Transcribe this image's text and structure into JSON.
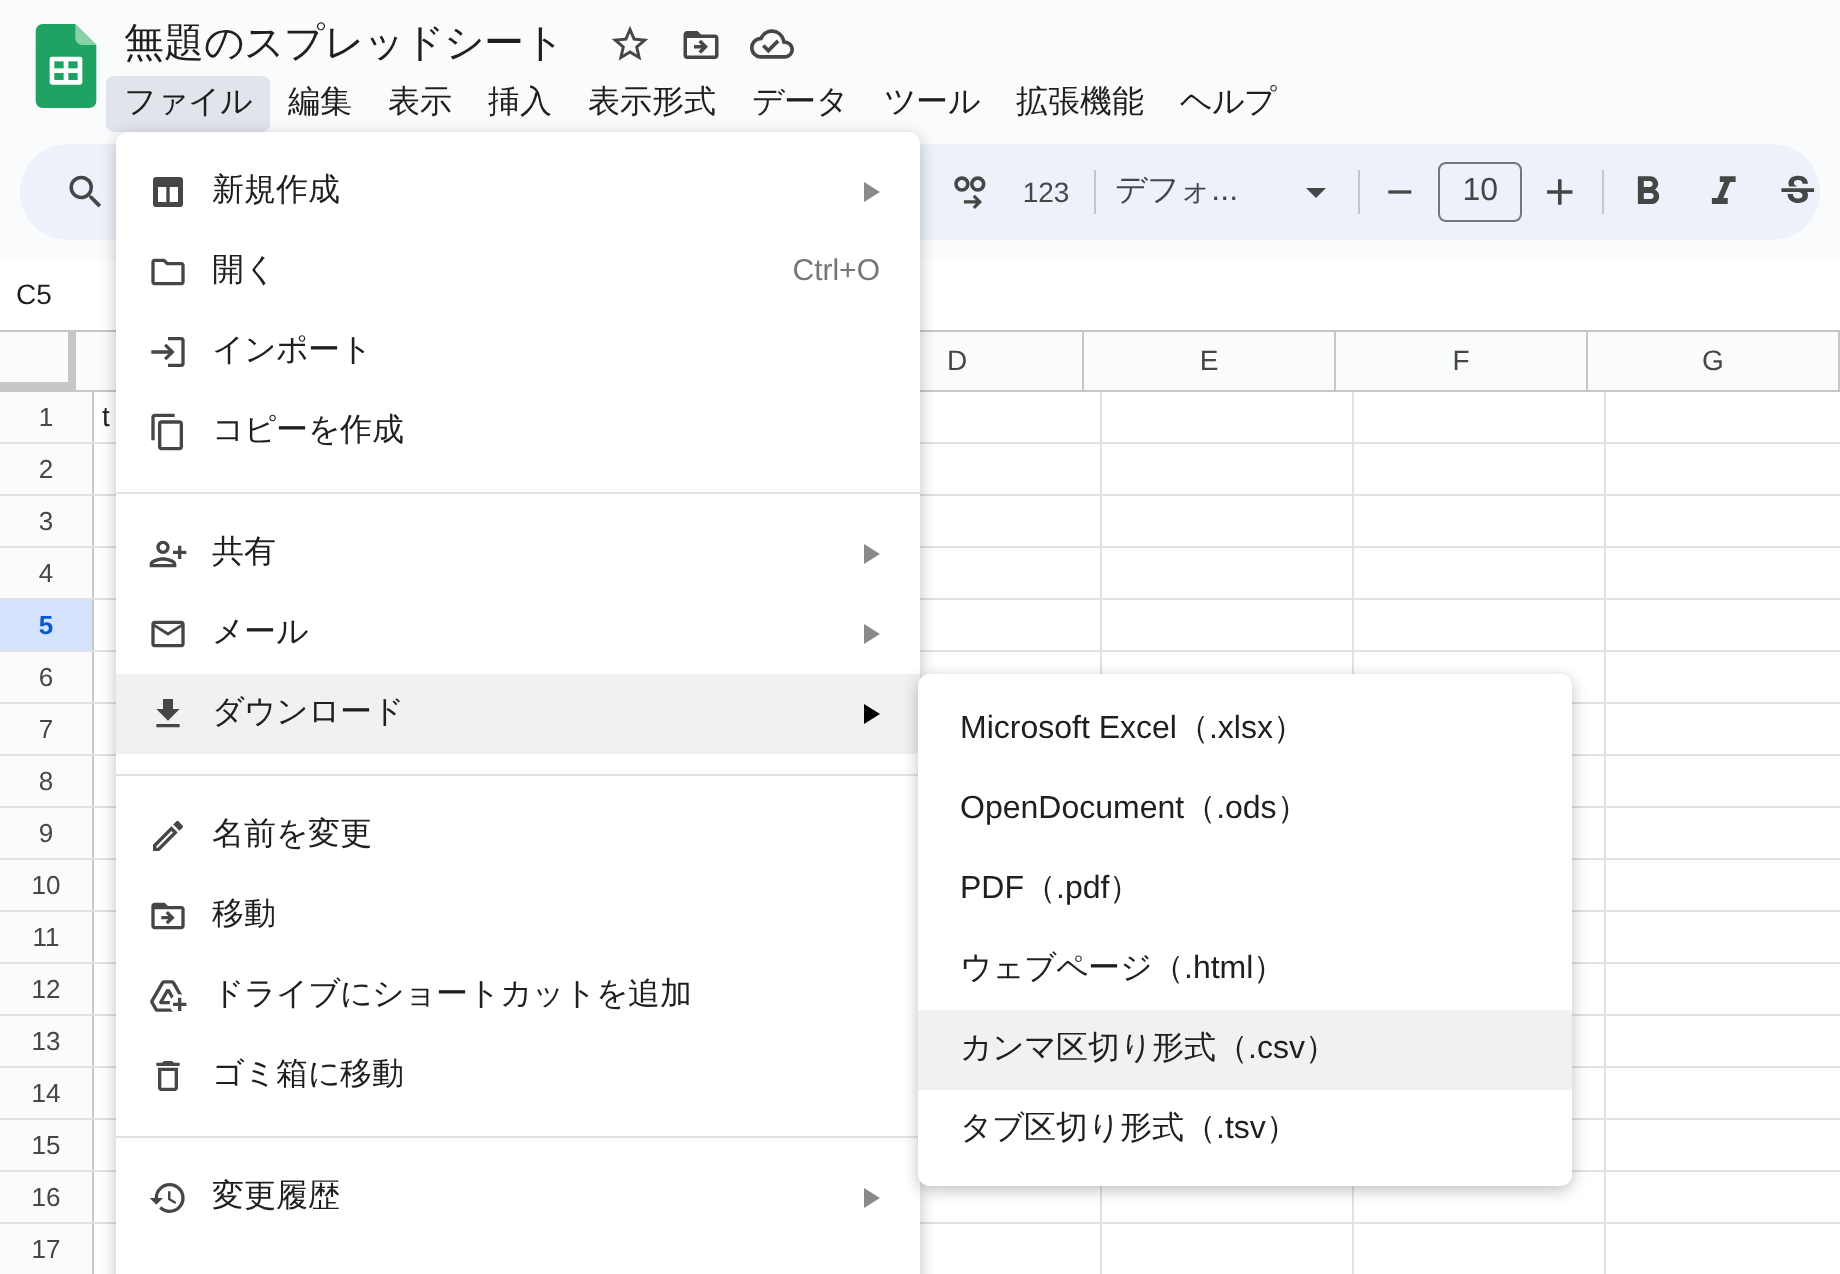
{
  "app": {
    "title": "無題のスプレッドシート"
  },
  "menu_bar": [
    {
      "label": "ファイル",
      "selected": true
    },
    {
      "label": "編集",
      "selected": false
    },
    {
      "label": "表示",
      "selected": false
    },
    {
      "label": "挿入",
      "selected": false
    },
    {
      "label": "表示形式",
      "selected": false
    },
    {
      "label": "データ",
      "selected": false
    },
    {
      "label": "ツール",
      "selected": false
    },
    {
      "label": "拡張機能",
      "selected": false
    },
    {
      "label": "ヘルプ",
      "selected": false
    }
  ],
  "toolbar": {
    "number_format": "123",
    "font": "デフォ...",
    "font_size": "10"
  },
  "name_box": "C5",
  "grid": {
    "columns": [
      "D",
      "E",
      "F",
      "G"
    ],
    "rows": [
      {
        "number": "1",
        "selected": false,
        "cell_a": "t"
      },
      {
        "number": "2",
        "selected": false
      },
      {
        "number": "3",
        "selected": false
      },
      {
        "number": "4",
        "selected": false
      },
      {
        "number": "5",
        "selected": true
      },
      {
        "number": "6",
        "selected": false
      },
      {
        "number": "7",
        "selected": false
      },
      {
        "number": "8",
        "selected": false
      },
      {
        "number": "9",
        "selected": false
      },
      {
        "number": "10",
        "selected": false
      },
      {
        "number": "11",
        "selected": false
      },
      {
        "number": "12",
        "selected": false
      },
      {
        "number": "13",
        "selected": false
      },
      {
        "number": "14",
        "selected": false
      },
      {
        "number": "15",
        "selected": false
      },
      {
        "number": "16",
        "selected": false
      },
      {
        "number": "17",
        "selected": false
      }
    ]
  },
  "file_menu": [
    {
      "kind": "item",
      "label": "新規作成",
      "submenu": true,
      "highlighted": false
    },
    {
      "kind": "item",
      "label": "開く",
      "shortcut": "Ctrl+O",
      "highlighted": false
    },
    {
      "kind": "item",
      "label": "インポート",
      "highlighted": false
    },
    {
      "kind": "item",
      "label": "コピーを作成",
      "highlighted": false
    },
    {
      "kind": "divider"
    },
    {
      "kind": "item",
      "label": "共有",
      "submenu": true,
      "highlighted": false
    },
    {
      "kind": "item",
      "label": "メール",
      "submenu": true,
      "highlighted": false
    },
    {
      "kind": "item",
      "label": "ダウンロード",
      "submenu": true,
      "highlighted": true
    },
    {
      "kind": "divider"
    },
    {
      "kind": "item",
      "label": "名前を変更",
      "highlighted": false
    },
    {
      "kind": "item",
      "label": "移動",
      "highlighted": false
    },
    {
      "kind": "item",
      "label": "ドライブにショートカットを追加",
      "highlighted": false
    },
    {
      "kind": "item",
      "label": "ゴミ箱に移動",
      "highlighted": false
    },
    {
      "kind": "divider"
    },
    {
      "kind": "item",
      "label": "変更履歴",
      "submenu": true,
      "highlighted": false
    }
  ],
  "download_submenu": [
    {
      "label": "Microsoft Excel（.xlsx）",
      "highlighted": false
    },
    {
      "label": "OpenDocument（.ods）",
      "highlighted": false
    },
    {
      "label": "PDF（.pdf）",
      "highlighted": false
    },
    {
      "label": "ウェブページ（.html）",
      "highlighted": false
    },
    {
      "label": "カンマ区切り形式（.csv）",
      "highlighted": true
    },
    {
      "label": "タブ区切り形式（.tsv）",
      "highlighted": false
    }
  ]
}
